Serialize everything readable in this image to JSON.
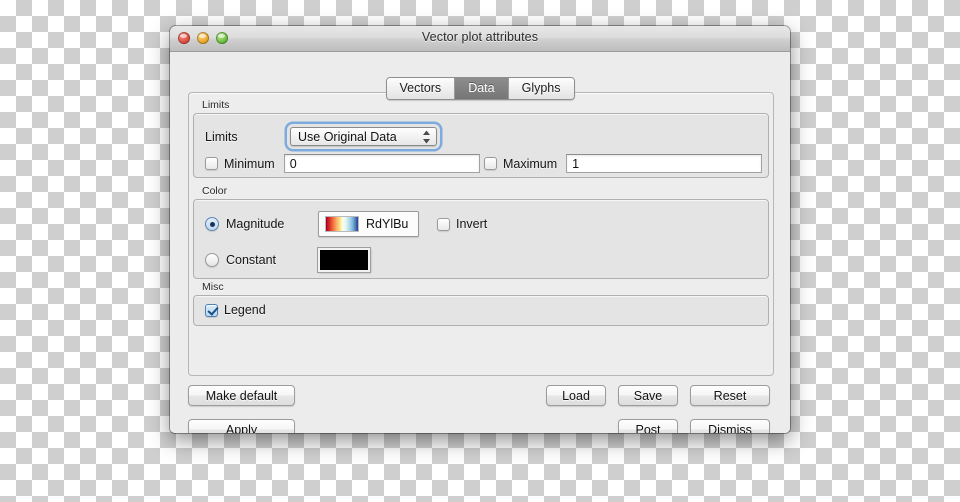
{
  "window": {
    "title": "Vector plot attributes",
    "traffic_lights": [
      "close-button",
      "minimize-button",
      "zoom-button"
    ]
  },
  "tabs": [
    {
      "label": "Vectors",
      "selected": false
    },
    {
      "label": "Data",
      "selected": true
    },
    {
      "label": "Glyphs",
      "selected": false
    }
  ],
  "limits": {
    "group_label": "Limits",
    "limits_label": "Limits",
    "mode_value": "Use Original Data",
    "mode_options": [
      "Use Original Data"
    ],
    "minimum_label": "Minimum",
    "minimum_checked": false,
    "minimum_value": "0",
    "maximum_label": "Maximum",
    "maximum_checked": false,
    "maximum_value": "1"
  },
  "color": {
    "group_label": "Color",
    "magnitude_label": "Magnitude",
    "magnitude_selected": true,
    "colortable_name": "RdYlBu",
    "colortable_colors": [
      "#a50026",
      "#d73027",
      "#f46d43",
      "#fdae61",
      "#fee090",
      "#ffffbf",
      "#e0f3f8",
      "#abd9e9",
      "#74add1",
      "#4575b4",
      "#313695"
    ],
    "invert_label": "Invert",
    "invert_checked": false,
    "constant_label": "Constant",
    "constant_selected": false,
    "constant_color": "#000000"
  },
  "misc": {
    "group_label": "Misc",
    "legend_label": "Legend",
    "legend_checked": true
  },
  "buttons": {
    "make_default": "Make default",
    "apply": "Apply",
    "load": "Load",
    "save": "Save",
    "reset": "Reset",
    "post": "Post",
    "dismiss": "Dismiss"
  },
  "accent": {
    "focus_ring": "#6ca1dc",
    "selected_tab_bg": "#7d7d7d",
    "checkbox_check": "#1c4e86"
  }
}
